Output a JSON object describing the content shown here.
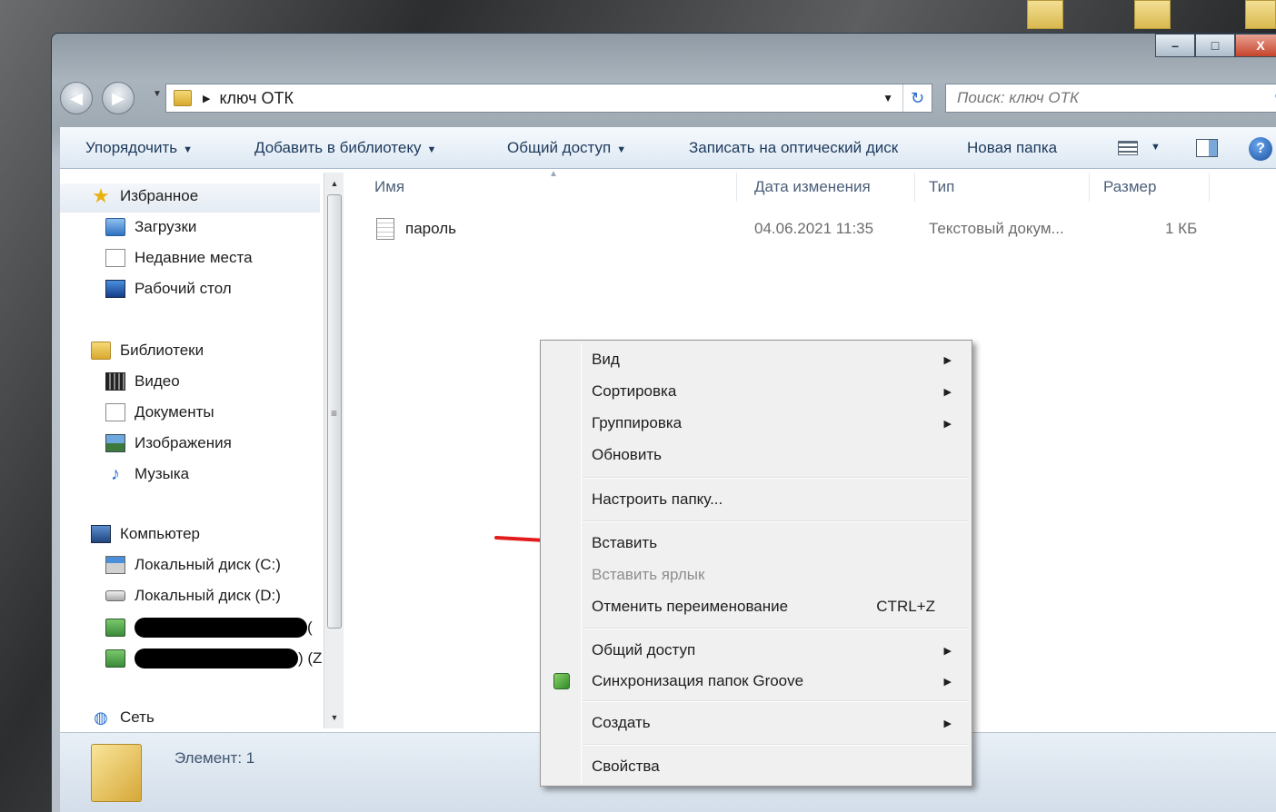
{
  "window": {
    "address": {
      "path_segment": "ключ ОТК"
    },
    "search": {
      "placeholder": "Поиск: ключ ОТК"
    },
    "caption": {
      "minimize": "–",
      "maximize": "□",
      "close": "X"
    }
  },
  "toolbar": {
    "organize": "Упорядочить",
    "add_to_library": "Добавить в библиотеку",
    "share": "Общий доступ",
    "burn": "Записать на оптический диск",
    "new_folder": "Новая папка"
  },
  "nav_pane": {
    "favorites": {
      "label": "Избранное",
      "items": [
        {
          "label": "Загрузки"
        },
        {
          "label": "Недавние места"
        },
        {
          "label": "Рабочий стол"
        }
      ]
    },
    "libraries": {
      "label": "Библиотеки",
      "items": [
        {
          "label": "Видео"
        },
        {
          "label": "Документы"
        },
        {
          "label": "Изображения"
        },
        {
          "label": "Музыка"
        }
      ]
    },
    "computer": {
      "label": "Компьютер",
      "items": [
        {
          "label": "Локальный диск (C:)"
        },
        {
          "label": "Локальный диск (D:)"
        },
        {
          "suffix": "("
        },
        {
          "suffix": ") (Z"
        }
      ]
    },
    "network": {
      "label": "Сеть"
    }
  },
  "file_list": {
    "columns": {
      "name": "Имя",
      "date": "Дата изменения",
      "type": "Тип",
      "size": "Размер"
    },
    "rows": [
      {
        "name": "пароль",
        "date": "04.06.2021 11:35",
        "type": "Текстовый докум...",
        "size": "1 КБ"
      }
    ]
  },
  "status_bar": {
    "text": "Элемент: 1"
  },
  "context_menu": {
    "items": [
      {
        "label": "Вид"
      },
      {
        "label": "Сортировка"
      },
      {
        "label": "Группировка"
      },
      {
        "label": "Обновить"
      },
      {
        "label": "Настроить папку..."
      },
      {
        "label": "Вставить"
      },
      {
        "label": "Вставить ярлык"
      },
      {
        "label": "Отменить переименование",
        "shortcut": "CTRL+Z"
      },
      {
        "label": "Общий доступ"
      },
      {
        "label": "Синхронизация папок Groove"
      },
      {
        "label": "Создать"
      },
      {
        "label": "Свойства"
      }
    ]
  },
  "colors": {
    "arrow": "#e31b1b",
    "toolbar_text": "#1e3a5c"
  },
  "icons": {
    "back": "arrow-left-icon",
    "forward": "arrow-right-icon",
    "refresh": "refresh-icon",
    "search": "search-icon",
    "help": "help-icon"
  }
}
